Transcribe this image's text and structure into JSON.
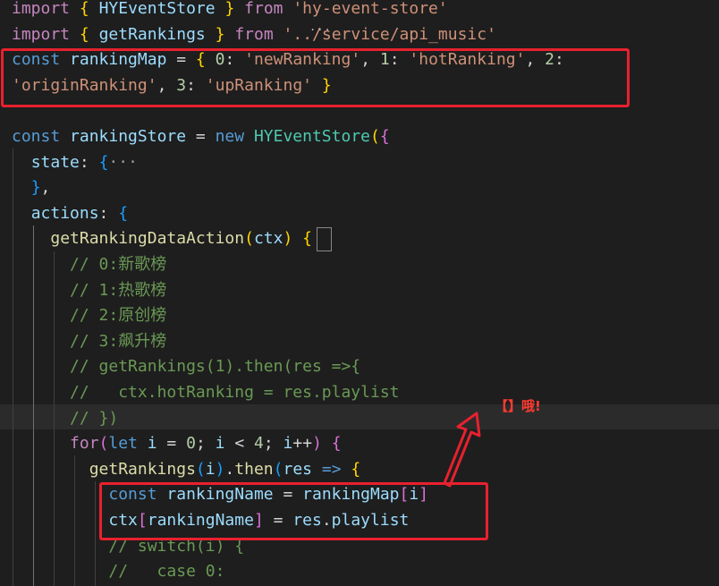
{
  "editor": {
    "lines": [
      [
        [
          "kw",
          "import"
        ],
        [
          "p",
          " "
        ],
        [
          "b1",
          "{"
        ],
        [
          "p",
          " "
        ],
        [
          "id",
          "HYEventStore"
        ],
        [
          "p",
          " "
        ],
        [
          "b1",
          "}"
        ],
        [
          "p",
          " "
        ],
        [
          "kw",
          "from"
        ],
        [
          "p",
          " "
        ],
        [
          "str",
          "'hy-event-store'"
        ]
      ],
      [
        [
          "kw",
          "import"
        ],
        [
          "p",
          " "
        ],
        [
          "b1",
          "{"
        ],
        [
          "p",
          " "
        ],
        [
          "id",
          "getRankings"
        ],
        [
          "p",
          " "
        ],
        [
          "b1",
          "}"
        ],
        [
          "p",
          " "
        ],
        [
          "kw",
          "from"
        ],
        [
          "p",
          " "
        ],
        [
          "str",
          "'../service/api_music'"
        ]
      ],
      [
        [
          "dec",
          "const"
        ],
        [
          "p",
          " "
        ],
        [
          "id",
          "rankingMap"
        ],
        [
          "p",
          " = "
        ],
        [
          "b1",
          "{"
        ],
        [
          "p",
          " "
        ],
        [
          "num",
          "0"
        ],
        [
          "p",
          ": "
        ],
        [
          "str",
          "'newRanking'"
        ],
        [
          "p",
          ", "
        ],
        [
          "num",
          "1"
        ],
        [
          "p",
          ": "
        ],
        [
          "str",
          "'hotRanking'"
        ],
        [
          "p",
          ", "
        ],
        [
          "num",
          "2"
        ],
        [
          "p",
          ":"
        ]
      ],
      [
        [
          "str",
          "'originRanking'"
        ],
        [
          "p",
          ", "
        ],
        [
          "num",
          "3"
        ],
        [
          "p",
          ": "
        ],
        [
          "str",
          "'upRanking'"
        ],
        [
          "p",
          " "
        ],
        [
          "b1",
          "}"
        ]
      ],
      [],
      [
        [
          "dec",
          "const"
        ],
        [
          "p",
          " "
        ],
        [
          "id",
          "rankingStore"
        ],
        [
          "p",
          " = "
        ],
        [
          "dec",
          "new"
        ],
        [
          "p",
          " "
        ],
        [
          "cls",
          "HYEventStore"
        ],
        [
          "b1",
          "("
        ],
        [
          "b2",
          "{"
        ]
      ],
      [
        [
          "p",
          "  "
        ],
        [
          "id",
          "state"
        ],
        [
          "p",
          ": "
        ],
        [
          "b3",
          "{"
        ],
        [
          "fold",
          "···"
        ]
      ],
      [
        [
          "p",
          "  "
        ],
        [
          "b3",
          "}"
        ],
        [
          "p",
          ","
        ]
      ],
      [
        [
          "p",
          "  "
        ],
        [
          "id",
          "actions"
        ],
        [
          "p",
          ": "
        ],
        [
          "b3",
          "{"
        ]
      ],
      [
        [
          "p",
          "    "
        ],
        [
          "fn",
          "getRankingDataAction"
        ],
        [
          "b1",
          "("
        ],
        [
          "id",
          "ctx"
        ],
        [
          "b1",
          ")"
        ],
        [
          "p",
          " "
        ],
        [
          "b1",
          "{"
        ]
      ],
      [
        [
          "p",
          "      "
        ],
        [
          "cm",
          "// 0:新歌榜"
        ]
      ],
      [
        [
          "p",
          "      "
        ],
        [
          "cm",
          "// 1:热歌榜"
        ]
      ],
      [
        [
          "p",
          "      "
        ],
        [
          "cm",
          "// 2:原创榜"
        ]
      ],
      [
        [
          "p",
          "      "
        ],
        [
          "cm",
          "// 3:飙升榜"
        ]
      ],
      [
        [
          "p",
          "      "
        ],
        [
          "cm",
          "// getRankings(1).then(res =>{"
        ]
      ],
      [
        [
          "p",
          "      "
        ],
        [
          "cm",
          "//   ctx.hotRanking = res.playlist"
        ]
      ],
      [
        [
          "p",
          "      "
        ],
        [
          "cm",
          "// })"
        ]
      ],
      [
        [
          "p",
          "      "
        ],
        [
          "kw",
          "for"
        ],
        [
          "b2",
          "("
        ],
        [
          "dec",
          "let"
        ],
        [
          "p",
          " "
        ],
        [
          "id",
          "i"
        ],
        [
          "p",
          " = "
        ],
        [
          "num",
          "0"
        ],
        [
          "p",
          "; "
        ],
        [
          "id",
          "i"
        ],
        [
          "p",
          " < "
        ],
        [
          "num",
          "4"
        ],
        [
          "p",
          "; "
        ],
        [
          "id",
          "i"
        ],
        [
          "p",
          "++"
        ],
        [
          "b2",
          ")"
        ],
        [
          "p",
          " "
        ],
        [
          "b2",
          "{"
        ]
      ],
      [
        [
          "p",
          "        "
        ],
        [
          "fn",
          "getRankings"
        ],
        [
          "b3",
          "("
        ],
        [
          "id",
          "i"
        ],
        [
          "b3",
          ")"
        ],
        [
          "p",
          "."
        ],
        [
          "fn",
          "then"
        ],
        [
          "b3",
          "("
        ],
        [
          "id",
          "res"
        ],
        [
          "p",
          " "
        ],
        [
          "dec",
          "=>"
        ],
        [
          "p",
          " "
        ],
        [
          "b1",
          "{"
        ]
      ],
      [
        [
          "p",
          "          "
        ],
        [
          "dec",
          "const"
        ],
        [
          "p",
          " "
        ],
        [
          "id",
          "rankingName"
        ],
        [
          "p",
          " = "
        ],
        [
          "id",
          "rankingMap"
        ],
        [
          "b2",
          "["
        ],
        [
          "id",
          "i"
        ],
        [
          "b2",
          "]"
        ]
      ],
      [
        [
          "p",
          "          "
        ],
        [
          "id",
          "ctx"
        ],
        [
          "b2",
          "["
        ],
        [
          "id",
          "rankingName"
        ],
        [
          "b2",
          "]"
        ],
        [
          "p",
          " = "
        ],
        [
          "id",
          "res"
        ],
        [
          "p",
          "."
        ],
        [
          "id",
          "playlist"
        ]
      ],
      [
        [
          "p",
          "          "
        ],
        [
          "cm",
          "// switch(i) {"
        ]
      ],
      [
        [
          "p",
          "          "
        ],
        [
          "cm",
          "//   case 0:"
        ]
      ]
    ]
  },
  "annotation": {
    "label": "【】哦!"
  }
}
